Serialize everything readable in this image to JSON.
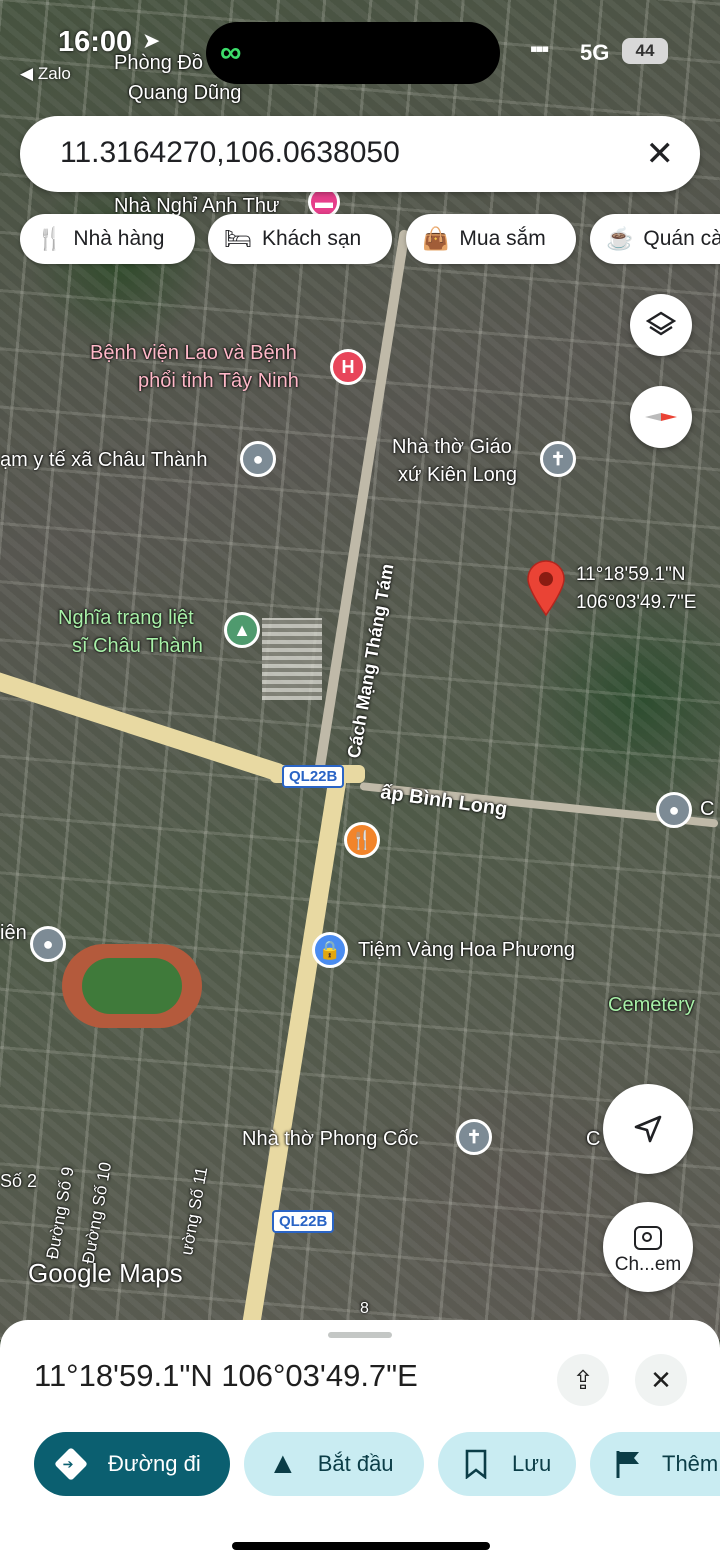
{
  "status": {
    "time": "16:00",
    "back_app": "Zalo",
    "network": "5G",
    "battery": "44"
  },
  "search": {
    "query": "11.3164270,106.0638050"
  },
  "chips": [
    {
      "icon": "restaurant-icon",
      "label": "Nhà hàng"
    },
    {
      "icon": "hotel-icon",
      "label": "Khách sạn"
    },
    {
      "icon": "shopping-bag-icon",
      "label": "Mua sắm"
    },
    {
      "icon": "cafe-icon",
      "label": "Quán cà phê"
    }
  ],
  "map": {
    "labels": {
      "phong_do": "Phòng Đồ",
      "quang_dung": "Quang Dũng",
      "nha_nghi": "Nhà Nghỉ Anh Thư",
      "hospital_1": "Bệnh viện Lao và Bệnh",
      "hospital_2": "phổi tỉnh Tây Ninh",
      "tram_yte": "ạm y tế xã Châu Thành",
      "church_1": "Nhà thờ Giáo",
      "church_2": "xứ Kiên Long",
      "cemetery_1": "Nghĩa trang liệt",
      "cemetery_2": "sĩ Châu Thành",
      "street_cmtt": "Cách Mạng Tháng Tám",
      "ap_binh_long": "ấp Bình Long",
      "jewelry": "Tiệm Vàng Hoa Phương",
      "cemetery_en": "Cemetery",
      "church_phong_coc": "Nhà thờ Phong Cốc",
      "duong_so_9": "Đường Số 9",
      "duong_so_10": "Đường Số 10",
      "duong_so_11": "ường Số 11",
      "so_2": "Số 2",
      "ien": "iên",
      "c_right": "C",
      "c_right2": "C",
      "num_8": "8",
      "watermark": "Google Maps"
    },
    "pin": {
      "lat": "11°18'59.1\"N",
      "lng": "106°03'49.7\"E",
      "color": "#ea4335"
    },
    "route_shields": [
      "QL22B",
      "QL22B"
    ],
    "camera_label": "Ch...em"
  },
  "sheet": {
    "coordinates": "11°18'59.1\"N 106°03'49.7\"E",
    "actions": [
      {
        "label": "Đường đi",
        "icon": "directions-icon",
        "primary": true
      },
      {
        "label": "Bắt đầu",
        "icon": "navigation-icon",
        "primary": false
      },
      {
        "label": "Lưu",
        "icon": "bookmark-icon",
        "primary": false
      },
      {
        "label": "Thêm",
        "icon": "flag-icon",
        "primary": false
      }
    ]
  },
  "colors": {
    "primary_button": "#0b5f70",
    "secondary_button": "#c9ecf2",
    "pin_red": "#ea4335",
    "road_yellow": "#e8d9a2"
  }
}
